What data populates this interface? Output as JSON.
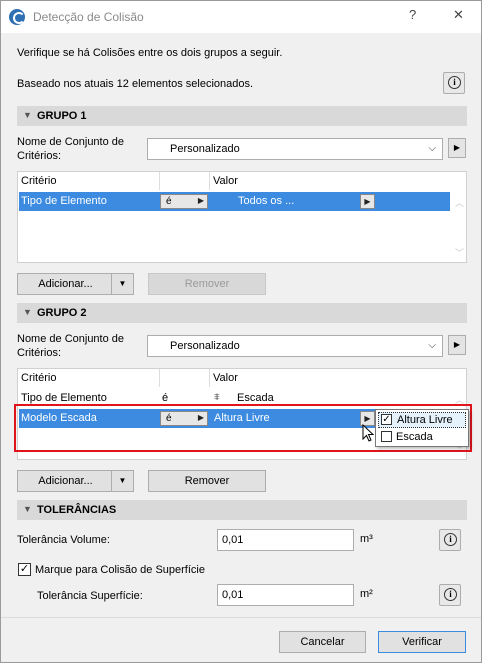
{
  "window": {
    "title": "Detecção de Colisão",
    "help_glyph": "?",
    "close_glyph": "✕"
  },
  "intro": {
    "line1": "Verifique se há Colisões entre os dois grupos a seguir.",
    "line2": "Baseado nos atuais 12 elementos selecionados."
  },
  "group1": {
    "header": "GRUPO 1",
    "criteria_set_label_1": "Nome de Conjunto de",
    "criteria_set_label_2": "Critérios:",
    "criteria_set_value": "Personalizado",
    "columns": [
      "Critério",
      "Valor"
    ],
    "rows": [
      {
        "criterion": "Tipo de Elemento",
        "operator": "é",
        "value": "Todos os ..."
      }
    ],
    "add_label": "Adicionar...",
    "remove_label": "Remover"
  },
  "group2": {
    "header": "GRUPO 2",
    "criteria_set_label_1": "Nome de Conjunto de",
    "criteria_set_label_2": "Critérios:",
    "criteria_set_value": "Personalizado",
    "columns": [
      "Critério",
      "Valor"
    ],
    "rows": [
      {
        "criterion": "Tipo de Elemento",
        "operator": "é",
        "value": "Escada"
      },
      {
        "criterion": "Modelo Escada",
        "operator": "é",
        "value": "Altura Livre"
      }
    ],
    "popup_options": [
      {
        "label": "Altura Livre",
        "checked": true
      },
      {
        "label": "Escada",
        "checked": false
      }
    ],
    "add_label": "Adicionar...",
    "remove_label": "Remover"
  },
  "tolerances": {
    "header": "TOLERÂNCIAS",
    "volume_label": "Tolerância Volume:",
    "volume_value": "0,01",
    "volume_unit": "m³",
    "surface_check_label": "Marque para Colisão de Superfície",
    "surface_check_checked": true,
    "surface_label": "Tolerância Superfície:",
    "surface_value": "0,01",
    "surface_unit": "m²"
  },
  "footer": {
    "cancel_label": "Cancelar",
    "verify_label": "Verificar"
  },
  "colors": {
    "selection": "#3c8be0",
    "highlight_border": "#e0141c"
  }
}
